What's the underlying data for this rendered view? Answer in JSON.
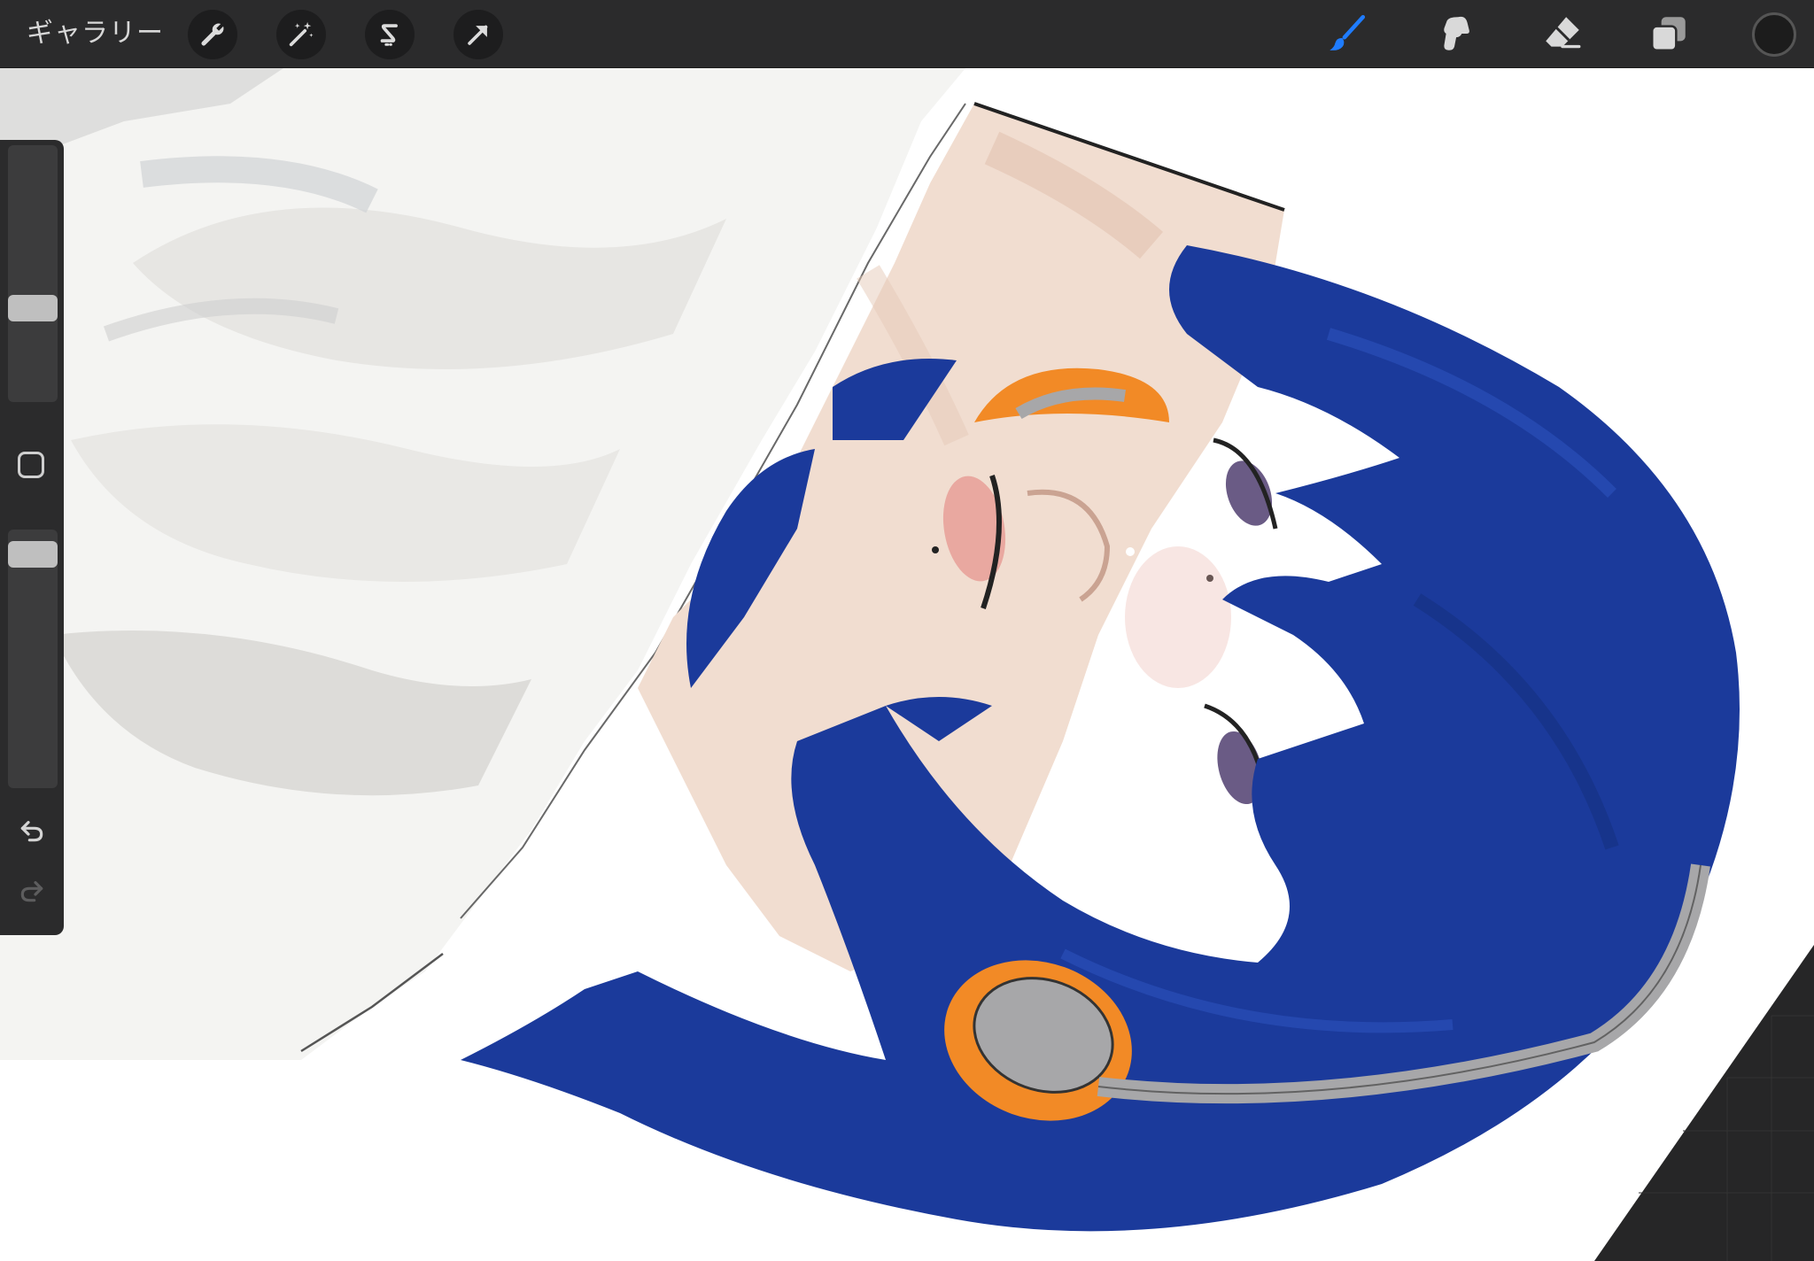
{
  "toolbar": {
    "gallery_label": "ギャラリー",
    "actions": [
      {
        "name": "wrench-icon"
      },
      {
        "name": "magic-wand-icon"
      },
      {
        "name": "selection-s-icon"
      },
      {
        "name": "transform-arrow-icon"
      }
    ],
    "tools": [
      {
        "name": "brush-icon",
        "active": true
      },
      {
        "name": "smudge-icon",
        "active": false
      },
      {
        "name": "eraser-icon",
        "active": false
      },
      {
        "name": "layers-icon",
        "active": false
      }
    ],
    "accent_color": "#1f7cff",
    "current_color": "#1c1c1c"
  },
  "sidebar": {
    "brush_size_level": 0.35,
    "opacity_level": 0.05,
    "undo_icon": "undo-icon",
    "redo_icon": "redo-icon"
  },
  "canvas": {
    "background": "#ffffff",
    "artwork": "illustration-blue-hair-headphones",
    "palette": {
      "hair": "#1b3a9b",
      "headphone_accent": "#f28a26",
      "headphone_gray": "#a7a7a9",
      "skin": "#f1ddd0",
      "shirt": "#f4f4f2"
    }
  }
}
